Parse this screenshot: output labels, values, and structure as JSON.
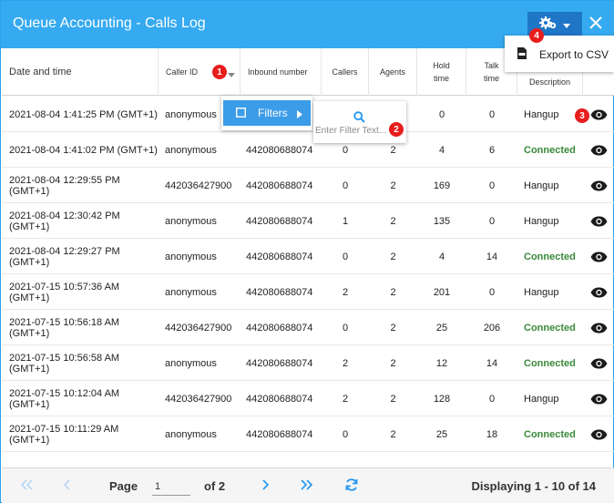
{
  "window": {
    "title": "Queue Accounting - Calls Log",
    "close_label": "✕"
  },
  "columns": {
    "date_time": "Date and time",
    "caller_id": "Caller ID",
    "inbound_number": "Inbound number",
    "callers": "Callers",
    "agents": "Agents",
    "hold_time_1": "Hold",
    "hold_time_2": "time",
    "talk_time_1": "Talk",
    "talk_time_2": "time",
    "description": "Description"
  },
  "rows": [
    {
      "date": "2021-08-04 1:41:25 PM (GMT+1)",
      "caller": "anonymous",
      "inbound": "",
      "callers": "",
      "agents": "",
      "hold": "0",
      "talk": "0",
      "desc": "Hangup"
    },
    {
      "date": "2021-08-04 1:41:02 PM (GMT+1)",
      "caller": "anonymous",
      "inbound": "442080688074",
      "callers": "0",
      "agents": "2",
      "hold": "4",
      "talk": "6",
      "desc": "Connected"
    },
    {
      "date": "2021-08-04 12:29:55 PM (GMT+1)",
      "caller": "442036427900",
      "inbound": "442080688074",
      "callers": "0",
      "agents": "2",
      "hold": "169",
      "talk": "0",
      "desc": "Hangup"
    },
    {
      "date": "2021-08-04 12:30:42 PM (GMT+1)",
      "caller": "anonymous",
      "inbound": "442080688074",
      "callers": "1",
      "agents": "2",
      "hold": "135",
      "talk": "0",
      "desc": "Hangup"
    },
    {
      "date": "2021-08-04 12:29:27 PM (GMT+1)",
      "caller": "anonymous",
      "inbound": "442080688074",
      "callers": "0",
      "agents": "2",
      "hold": "4",
      "talk": "14",
      "desc": "Connected"
    },
    {
      "date": "2021-07-15 10:57:36 AM (GMT+1)",
      "caller": "anonymous",
      "inbound": "442080688074",
      "callers": "2",
      "agents": "2",
      "hold": "201",
      "talk": "0",
      "desc": "Hangup"
    },
    {
      "date": "2021-07-15 10:56:18 AM (GMT+1)",
      "caller": "442036427900",
      "inbound": "442080688074",
      "callers": "0",
      "agents": "2",
      "hold": "25",
      "talk": "206",
      "desc": "Connected"
    },
    {
      "date": "2021-07-15 10:56:58 AM (GMT+1)",
      "caller": "anonymous",
      "inbound": "442080688074",
      "callers": "2",
      "agents": "2",
      "hold": "12",
      "talk": "14",
      "desc": "Connected"
    },
    {
      "date": "2021-07-15 10:12:04 AM (GMT+1)",
      "caller": "442036427900",
      "inbound": "442080688074",
      "callers": "2",
      "agents": "2",
      "hold": "128",
      "talk": "0",
      "desc": "Hangup"
    },
    {
      "date": "2021-07-15 10:11:29 AM (GMT+1)",
      "caller": "anonymous",
      "inbound": "442080688074",
      "callers": "0",
      "agents": "2",
      "hold": "25",
      "talk": "18",
      "desc": "Connected"
    }
  ],
  "menu": {
    "filters_label": "Filters",
    "filter_placeholder": "Enter Filter Text..."
  },
  "export": {
    "label": "Export to CSV"
  },
  "pager": {
    "page_label": "Page",
    "page_value": "1",
    "of_label": "of 2",
    "displaying": "Displaying 1 - 10 of 14"
  },
  "badges": [
    "1",
    "2",
    "3",
    "4"
  ],
  "colors": {
    "title_bar": "#35aaf0",
    "gear_button": "#1f76c7",
    "menu_highlight": "#3b9ce8",
    "connected_text": "#3a8a3a",
    "badge": "#e81d1d",
    "pager_icons": "#2196f3"
  },
  "icons": {
    "settings": "gear-icon",
    "close": "close-icon",
    "sort": "caret-down-icon",
    "filter": "checkbox-icon",
    "submenu": "arrow-right-icon",
    "search": "search-icon",
    "export": "csv-file-icon",
    "view": "eye-icon",
    "first": "double-chevron-left-icon",
    "prev": "chevron-left-icon",
    "next": "chevron-right-icon",
    "last": "double-chevron-right-icon",
    "refresh": "refresh-icon"
  }
}
